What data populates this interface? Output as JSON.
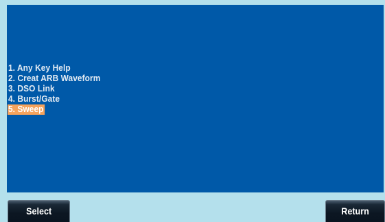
{
  "menu": {
    "items": [
      {
        "label": "1. Any Key Help",
        "selected": false
      },
      {
        "label": "2. Creat ARB Waveform",
        "selected": false
      },
      {
        "label": "3. DSO Link",
        "selected": false
      },
      {
        "label": "4. Burst/Gate",
        "selected": false
      },
      {
        "label": "5. Sweep",
        "selected": true
      }
    ]
  },
  "softkeys": {
    "select_label": "Select",
    "return_label": "Return"
  },
  "colors": {
    "panel_background": "#0059a8",
    "screen_background": "#b4e0ec",
    "menu_text": "#e4ecf4",
    "selected_highlight": "#f6a35c",
    "softkey_background": "#0c1622"
  }
}
